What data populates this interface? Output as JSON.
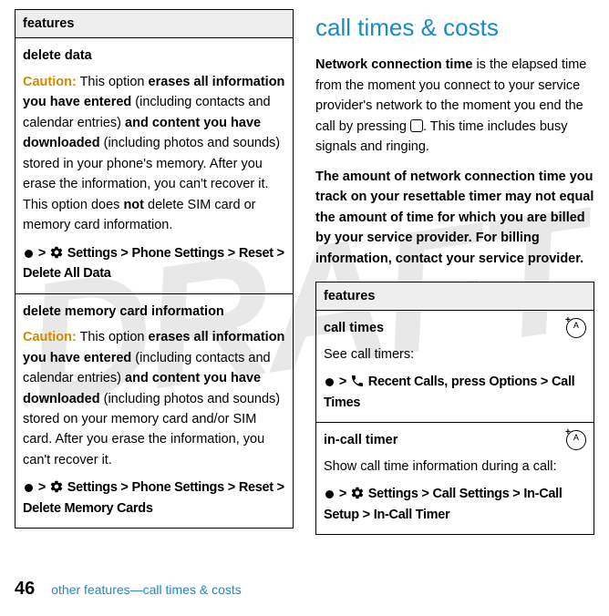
{
  "watermark": "DRAFT",
  "left": {
    "table_header": "features",
    "row1": {
      "title": "delete data",
      "caution_label": "Caution:",
      "text_a": " This option ",
      "bold_a": "erases all information you have entered",
      "text_b": " (including contacts and calendar entries) ",
      "bold_b": "and content you have downloaded",
      "text_c": " (including photos and sounds) stored in your phone's memory. After you erase the information, you can't recover it. This option does ",
      "bold_c": "not",
      "text_d": " delete SIM card or memory card information.",
      "path_gt1": " > ",
      "path_settings": "Settings",
      "path_gt2": " > ",
      "path_phone": "Phone Settings",
      "path_gt3": " > ",
      "path_reset": "Reset",
      "path_gt4": " > ",
      "path_delete": "Delete All Data"
    },
    "row2": {
      "title": "delete memory card information",
      "caution_label": "Caution:",
      "text_a": " This option ",
      "bold_a": "erases all information you have entered",
      "text_b": " (including contacts and calendar entries) ",
      "bold_b": "and content you have downloaded",
      "text_c": " (including photos and sounds) stored on your memory card and/or SIM card. After you erase the information, you can't recover it.",
      "path_gt1": " > ",
      "path_settings": "Settings",
      "path_gt2": " > ",
      "path_phone": "Phone Settings",
      "path_gt3": " > ",
      "path_reset": "Reset",
      "path_gt4": " > ",
      "path_delete": "Delete Memory Cards"
    }
  },
  "right": {
    "heading": "call times & costs",
    "p1_a": "Network connection time",
    "p1_b": " is the elapsed time from the moment you connect to your service provider's network to the moment you end the call by pressing ",
    "p1_c": ". This time includes busy signals and ringing.",
    "p2": "The amount of network connection time you track on your resettable timer may not equal the amount of time for which you are billed by your service provider. For billing information, contact your service provider.",
    "table_header": "features",
    "row1": {
      "title": "call times",
      "text": "See call timers:",
      "gt1": " > ",
      "recent": "Recent Calls",
      "press": ", press ",
      "options": "Options",
      "gt2": " > ",
      "calltimes": "Call Times"
    },
    "row2": {
      "title": "in-call timer",
      "text": "Show call time information during a call:",
      "gt1": " > ",
      "settings": "Settings",
      "gt2": " > ",
      "callsettings": "Call Settings",
      "gt3": " > ",
      "incallsetup": "In-Call Setup",
      "gt4": " > ",
      "incalltimer": "In-Call Timer"
    }
  },
  "footer": {
    "page": "46",
    "breadcrumb": "other features—call times & costs"
  }
}
